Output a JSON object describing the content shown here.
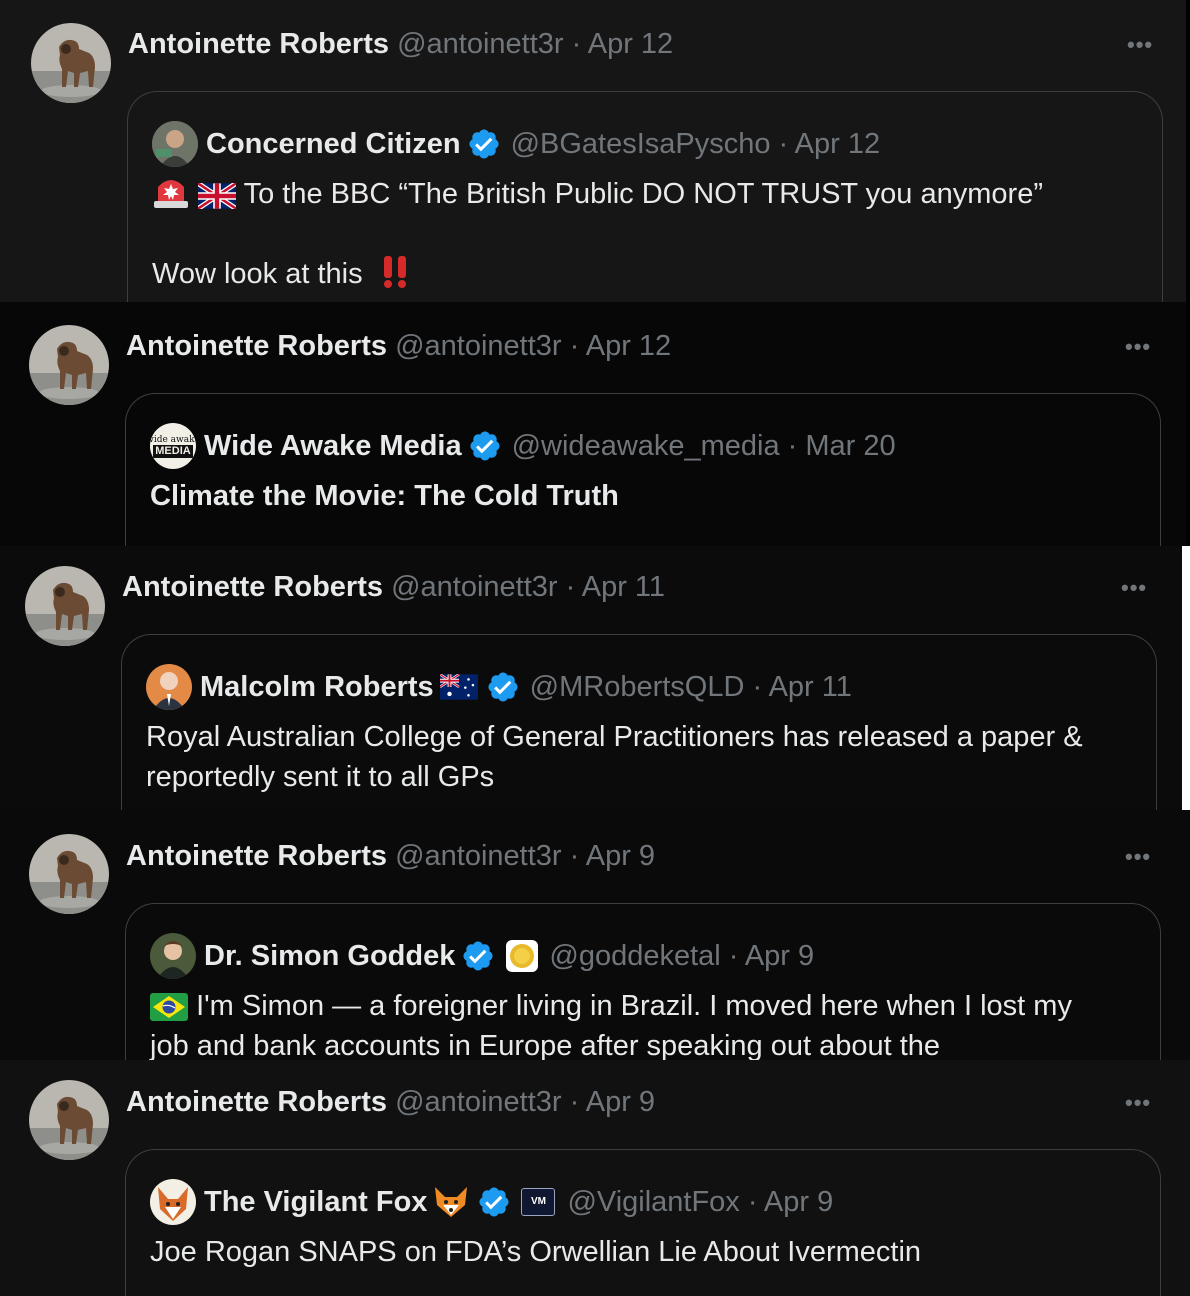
{
  "tweets": [
    {
      "author": "Antoinette Roberts",
      "handle": "@antoinett3r",
      "date": "· Apr 12",
      "more": "•••",
      "quote": {
        "name": "Concerned Citizen",
        "handle": "@BGatesIsaPyscho",
        "date": "· Apr 12",
        "line1": "To the BBC  “The British Public DO NOT TRUST you anymore”",
        "line2": "Wow look at this"
      }
    },
    {
      "author": "Antoinette Roberts",
      "handle": "@antoinett3r",
      "date": "· Apr 12",
      "more": "•••",
      "quote": {
        "name": "Wide Awake Media",
        "handle": "@wideawake_media",
        "date": "· Mar 20",
        "avatar_text_top": "wide awake",
        "avatar_text_bottom": "MEDIA",
        "line1": "Climate the Movie: The Cold Truth"
      }
    },
    {
      "author": "Antoinette Roberts",
      "handle": "@antoinett3r",
      "date": "· Apr 11",
      "more": "•••",
      "quote": {
        "name": "Malcolm Roberts",
        "handle": "@MRobertsQLD",
        "date": "· Apr 11",
        "line1": "Royal Australian College of General Practitioners has released a paper &",
        "line2": "reportedly sent it to all GPs"
      }
    },
    {
      "author": "Antoinette Roberts",
      "handle": "@antoinett3r",
      "date": "· Apr 9",
      "more": "•••",
      "quote": {
        "name": "Dr. Simon Goddek",
        "handle": "@goddeketal",
        "date": "· Apr 9",
        "line1": "I'm Simon — a foreigner living in Brazil. I moved here when I lost my",
        "line2": "job and bank accounts in Europe after speaking out about the"
      }
    },
    {
      "author": "Antoinette Roberts",
      "handle": "@antoinett3r",
      "date": "· Apr 9",
      "more": "•••",
      "quote": {
        "name": "The Vigilant Fox",
        "handle": "@VigilantFox",
        "date": "· Apr 9",
        "badge_text": "VM",
        "line1": "Joe Rogan SNAPS on FDA’s Orwellian Lie About Ivermectin"
      }
    }
  ],
  "colors": {
    "background": "#000000",
    "text": "#e7e9ea",
    "muted": "#71767b",
    "border": "#3b3f43",
    "verified": "#1d9bf0",
    "separator": "#ffffff"
  }
}
